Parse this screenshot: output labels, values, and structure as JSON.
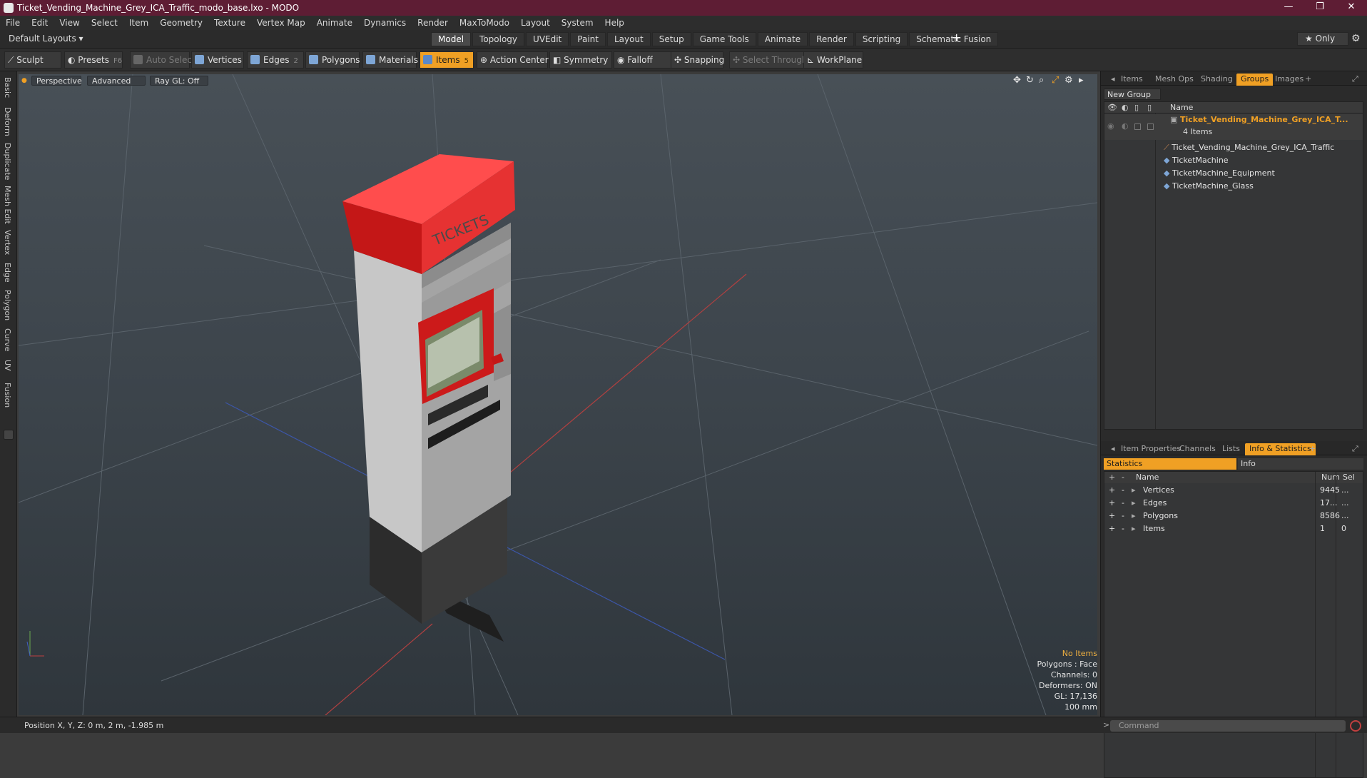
{
  "window": {
    "title": "Ticket_Vending_Machine_Grey_ICA_Traffic_modo_base.lxo - MODO",
    "minimize": "—",
    "maximize": "❐",
    "close": "✕"
  },
  "menu": [
    "File",
    "Edit",
    "View",
    "Select",
    "Item",
    "Geometry",
    "Texture",
    "Vertex Map",
    "Animate",
    "Dynamics",
    "Render",
    "MaxToModo",
    "Layout",
    "System",
    "Help"
  ],
  "layout": {
    "name": "Default Layouts ▾",
    "tabs": [
      "Model",
      "Topology",
      "UVEdit",
      "Paint",
      "Layout",
      "Setup",
      "Game Tools",
      "Animate",
      "Render",
      "Scripting",
      "Schematic Fusion"
    ],
    "active": "Model",
    "add": "+",
    "only": "★  Only"
  },
  "toolbar": {
    "sculpt": "Sculpt",
    "presets": "Presets",
    "presets_key": "F6",
    "auto_select": "Auto Select",
    "vertices": "Vertices",
    "vertices_key": "1",
    "edges": "Edges",
    "edges_key": "2",
    "polygons": "Polygons",
    "materials": "Materials",
    "items": "Items",
    "items_key": "5",
    "action_center": "Action Center",
    "symmetry": "Symmetry",
    "falloff": "Falloff",
    "snapping": "Snapping",
    "select_through": "Select Through",
    "workplane": "WorkPlane"
  },
  "left_tabs": [
    "Basic",
    "Deform",
    "Duplicate",
    "Mesh Edit",
    "Vertex",
    "Edge",
    "Polygon",
    "Curve",
    "UV",
    "Fusion"
  ],
  "viewport": {
    "view": "Perspective",
    "shading": "Advanced",
    "raygl": "Ray GL: Off",
    "hud": {
      "selection": "No Items",
      "polygons": "Polygons : Face",
      "channels": "Channels: 0",
      "deformers": "Deformers: ON",
      "gl": "GL: 17,136",
      "scale": "100 mm"
    },
    "model_text": "TICKETS"
  },
  "groups_panel": {
    "tabs": [
      "Items",
      "Mesh Ops",
      "Shading",
      "Groups",
      "Images"
    ],
    "active": "Groups",
    "new_group": "New Group",
    "name_header": "Name",
    "group_name": "Ticket_Vending_Machine_Grey_ICA_T...",
    "group_count": "4 Items",
    "children": [
      "Ticket_Vending_Machine_Grey_ICA_Traffic",
      "TicketMachine",
      "TicketMachine_Equipment",
      "TicketMachine_Glass"
    ]
  },
  "stats_panel": {
    "tabs": [
      "Item Properties",
      "Channels",
      "Lists",
      "Info & Statistics"
    ],
    "active": "Info & Statistics",
    "subtabs": [
      "Statistics",
      "Info"
    ],
    "headers": {
      "name": "Name",
      "num": "Num",
      "sel": "Sel"
    },
    "rows": [
      {
        "name": "Vertices",
        "num": "9445",
        "sel": "..."
      },
      {
        "name": "Edges",
        "num": "17...",
        "sel": "..."
      },
      {
        "name": "Polygons",
        "num": "8586",
        "sel": "..."
      },
      {
        "name": "Items",
        "num": "1",
        "sel": "0"
      }
    ]
  },
  "status": {
    "position": "Position X, Y, Z:   0 m, 2 m, -1.985 m",
    "command_placeholder": "Command"
  },
  "colors": {
    "titlebar": "#5e1d34",
    "accent": "#f0a024",
    "machine_red": "#d31f1f",
    "machine_grey": "#a9a9a9"
  }
}
